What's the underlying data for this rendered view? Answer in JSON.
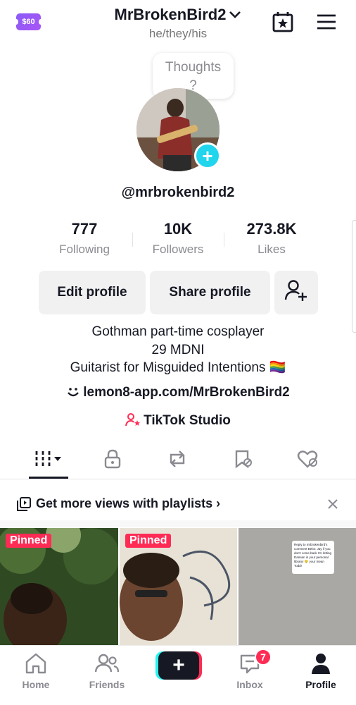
{
  "header": {
    "coin_label": "$60",
    "username": "MrBrokenBird2",
    "pronouns": "he/they/his"
  },
  "thought_bubble": {
    "text": "Thoughts ?"
  },
  "profile": {
    "handle": "@mrbrokenbird2"
  },
  "stats": [
    {
      "value": "777",
      "label": "Following"
    },
    {
      "value": "10K",
      "label": "Followers"
    },
    {
      "value": "273.8K",
      "label": "Likes"
    }
  ],
  "actions": {
    "edit_label": "Edit profile",
    "share_label": "Share profile"
  },
  "bio": {
    "line1": "Gothman part-time cosplayer",
    "line2": "29 MDNI",
    "line3": "Guitarist for Misguided Intentions 🏳️‍🌈",
    "link": "lemon8-app.com/MrBrokenBird2",
    "studio": "TikTok Studio"
  },
  "tabs": [
    "videos-grid-icon",
    "lock-icon",
    "repost-icon",
    "bookmark-icon",
    "liked-hidden-icon"
  ],
  "playlist_banner": {
    "text": "Get more views with playlists ›"
  },
  "grid": {
    "pinned_label": "Pinned",
    "note_text": "Reply to mrbrokenbird's comment Bebs: Jay if you don't come back I'm letting Damian in your personal library! 😤 your mean Todd!"
  },
  "bottom_nav": {
    "home": "Home",
    "friends": "Friends",
    "inbox": "Inbox",
    "inbox_badge": "7",
    "profile": "Profile"
  },
  "colors": {
    "accent_red": "#fe2c55",
    "accent_cyan": "#20d5ec",
    "text_primary": "#161823",
    "text_secondary": "#8a8b91"
  }
}
